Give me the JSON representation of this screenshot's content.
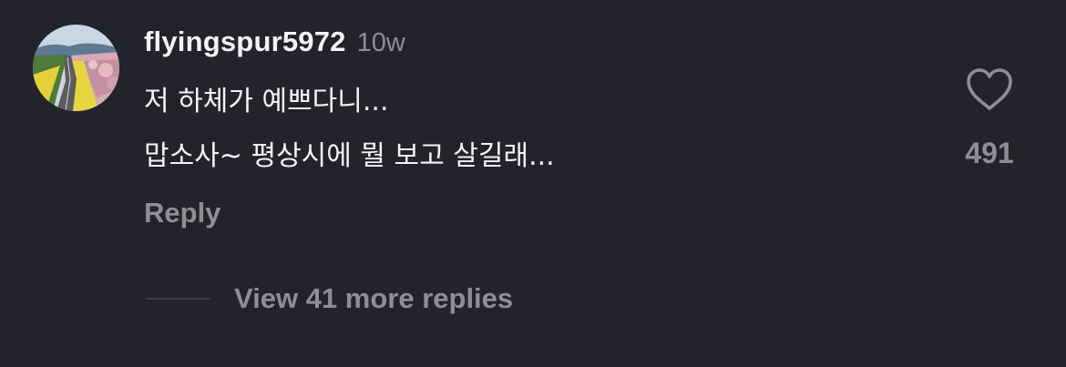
{
  "comment": {
    "username": "flyingspur5972",
    "timestamp": "10w",
    "lines": [
      "저 하체가 예쁘다니...",
      "맙소사~ 평상시에 뭘 보고 살길래..."
    ],
    "reply_label": "Reply",
    "like_count": "491",
    "like_icon": "heart-outline-icon",
    "avatar_image": "road-with-yellow-flowers-and-cherry-blossoms"
  },
  "replies": {
    "view_more_label": "View 41 more replies"
  },
  "colors": {
    "background": "#23242b",
    "primary_text": "#f4f4f6",
    "secondary_text": "#8e8f96",
    "divider": "#3d3e46"
  }
}
